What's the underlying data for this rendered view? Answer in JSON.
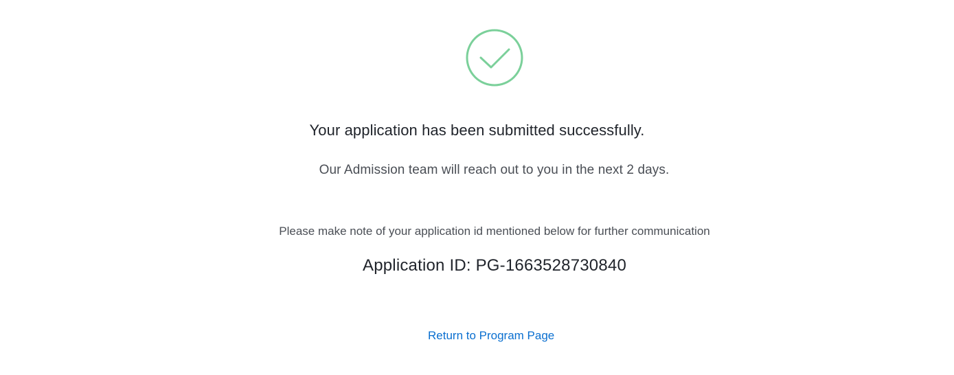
{
  "status": {
    "icon": "success-check-circle-icon",
    "icon_color": "#7bd09a",
    "title": "Your application has been submitted successfully.",
    "subtitle": "Our Admission team will reach out to you in the next 2 days."
  },
  "application": {
    "note": "Please make note of your application id mentioned below for further communication",
    "id_text": "Application ID: PG-1663528730840"
  },
  "actions": {
    "return_label": "Return to Program Page",
    "link_color": "#0a6fd0"
  }
}
